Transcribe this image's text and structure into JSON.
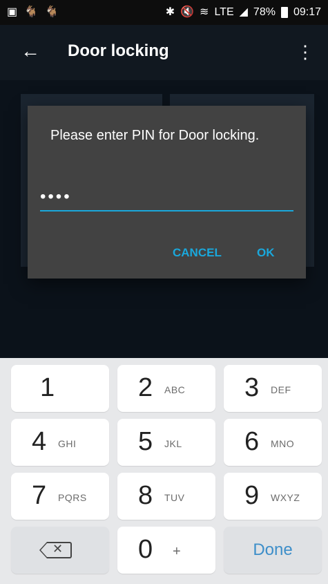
{
  "status_bar": {
    "left_icons": [
      "image-icon",
      "animal-icon",
      "animal-icon"
    ],
    "right_text": "78%",
    "time": "09:17",
    "network_label": "LTE"
  },
  "app_bar": {
    "title": "Door locking",
    "back_icon": "arrow-left-icon",
    "menu_icon": "more-vert-icon"
  },
  "dialog": {
    "message": "Please enter PIN for Door locking.",
    "pin_value": "••••",
    "cancel_label": "CANCEL",
    "ok_label": "OK",
    "accent_color": "#1aa8dc"
  },
  "keyboard": {
    "rows": [
      [
        {
          "num": "1",
          "letters": ""
        },
        {
          "num": "2",
          "letters": "ABC"
        },
        {
          "num": "3",
          "letters": "DEF"
        }
      ],
      [
        {
          "num": "4",
          "letters": "GHI"
        },
        {
          "num": "5",
          "letters": "JKL"
        },
        {
          "num": "6",
          "letters": "MNO"
        }
      ],
      [
        {
          "num": "7",
          "letters": "PQRS"
        },
        {
          "num": "8",
          "letters": "TUV"
        },
        {
          "num": "9",
          "letters": "WXYZ"
        }
      ],
      [
        {
          "num": "",
          "letters": ""
        },
        {
          "num": "0",
          "letters": "+"
        },
        {
          "num": "",
          "letters": ""
        }
      ]
    ],
    "done_label": "Done"
  }
}
